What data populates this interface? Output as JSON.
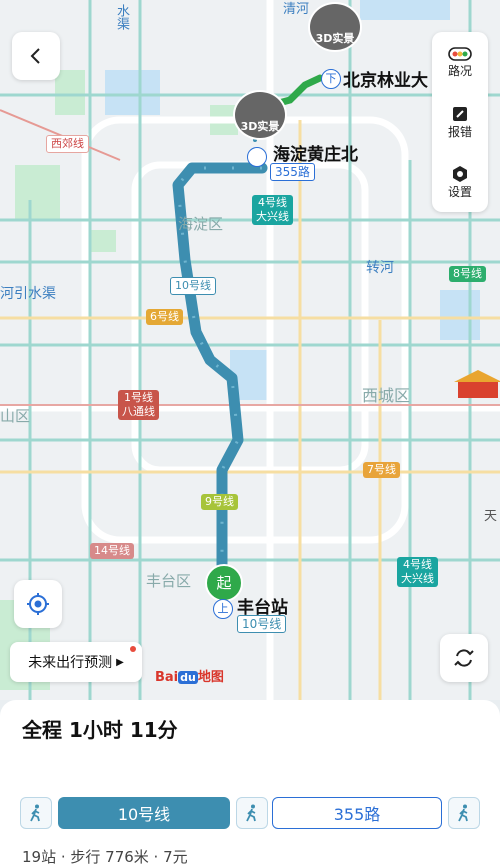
{
  "map": {
    "labels": {
      "water_ditch": "水渠",
      "river_top": "清河",
      "xijiao": "西郊线",
      "haidian": "海淀区",
      "jingmi": "河引水渠",
      "zhuhe": "转河",
      "xicheng": "西城区",
      "shanqu": "山区",
      "fengtai": "丰台区",
      "tian": "天"
    },
    "line_tags": {
      "l4_top": "4号线\n大兴线",
      "l10_mid": "10号线",
      "l6": "6号线",
      "l8": "8号线",
      "l1": "1号线\n八通线",
      "l7": "7号线",
      "l9": "9号线",
      "l14": "14号线",
      "l4_bot": "4号线\n大兴线"
    },
    "stations": {
      "dest_name": "北京林业大",
      "transfer_name": "海淀黄庄北",
      "transfer_route": "355路",
      "start_name": "丰台站",
      "start_line": "10号线",
      "start_marker": "起",
      "board_marker": "上",
      "alight_marker": "下"
    },
    "badges": {
      "live3d": "3D实景"
    },
    "logo": {
      "bai": "Bai",
      "du": "du",
      "ditu": "地图"
    }
  },
  "controls": {
    "traffic": "路况",
    "report": "报错",
    "settings": "设置",
    "forecast": "未来出行预测"
  },
  "route": {
    "total": "全程 1小时 11分",
    "segments": [
      {
        "label": "10号线"
      },
      {
        "label": "355路"
      }
    ],
    "summary": "19站 · 步行 776米 · 7元"
  },
  "colors": {
    "subway_route": "#3d8eb0",
    "bus_route": "#2fa94a",
    "accent_blue": "#2b6fd6"
  }
}
